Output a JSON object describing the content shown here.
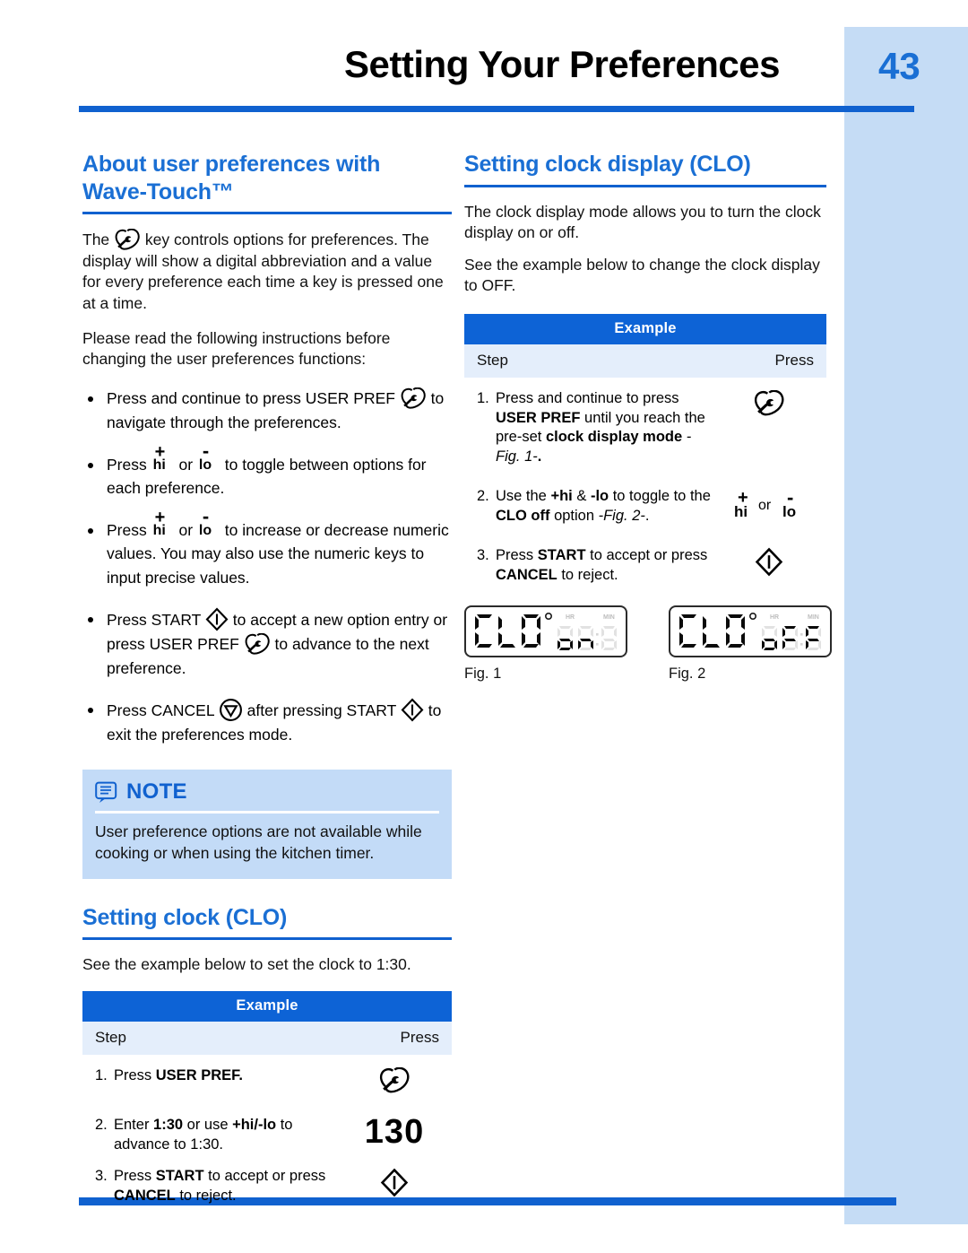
{
  "header": {
    "title": "Setting Your Preferences",
    "page_number": "43"
  },
  "colors": {
    "accent_blue": "#1a6fd4",
    "rule_blue": "#1061cf",
    "table_header_blue": "#0d63d6",
    "table_sub_blue": "#e4eefb",
    "note_bg": "#c3dbf7",
    "edge_band": "#c5dcf5"
  },
  "left_column": {
    "section1": {
      "heading_line1": "About user preferences with",
      "heading_line2": "Wave-Touch™",
      "para1_a": "The ",
      "para1_b": " key controls options for preferences. The display will show a digital abbreviation and a value for every preference each time a key is pressed one at a time.",
      "para2": "Please read the following instructions before changing the user preferences functions:",
      "bullets": [
        {
          "t1": "Press and continue to press USER PREF ",
          "t2": " to navigate through the preferences."
        },
        {
          "t1": "Press ",
          "t2": " or ",
          "t3": " to toggle between options for each preference."
        },
        {
          "t1": "Press ",
          "t2": " or ",
          "t3": " to increase or decrease numeric values. You may also use the numeric keys to input precise values."
        },
        {
          "t1": "Press START ",
          "t2": " to accept a new option entry or press USER PREF ",
          "t3": " to advance to the next preference."
        },
        {
          "t1": "Press CANCEL ",
          "t2": " after pressing START ",
          "t3": " to exit the preferences mode."
        }
      ]
    },
    "note": {
      "title": "NOTE",
      "body": "User preference options are not available while cooking or when using the kitchen timer."
    },
    "section2": {
      "heading": "Setting clock (CLO)",
      "intro": "See the example below to set the clock to 1:30.",
      "table": {
        "title": "Example",
        "col_step": "Step",
        "col_press": "Press",
        "rows": [
          {
            "number": "1.",
            "parts": [
              {
                "text": "Press ",
                "bold": false
              },
              {
                "text": "USER PREF.",
                "bold": true
              }
            ],
            "press_icon": "user-pref-icon"
          },
          {
            "number": "2.",
            "parts": [
              {
                "text": "Enter ",
                "bold": false
              },
              {
                "text": "1:30",
                "bold": true
              },
              {
                "text": " or use ",
                "bold": false
              },
              {
                "text": "+hi/-lo",
                "bold": true
              },
              {
                "text": " to advance to 1:30.",
                "bold": false
              }
            ],
            "press_value": "130"
          },
          {
            "number": "3.",
            "parts": [
              {
                "text": "Press ",
                "bold": false
              },
              {
                "text": "START",
                "bold": true
              },
              {
                "text": " to accept or press ",
                "bold": false
              },
              {
                "text": "CANCEL",
                "bold": true
              },
              {
                "text": " to reject.",
                "bold": false
              }
            ],
            "press_icon": "start-icon"
          }
        ]
      }
    }
  },
  "right_column": {
    "section": {
      "heading": "Setting clock display (CLO)",
      "para1": "The clock display mode allows you to turn the clock display on or off.",
      "para2": "See the example below to change the clock display to OFF.",
      "table": {
        "title": "Example",
        "col_step": "Step",
        "col_press": "Press",
        "rows": [
          {
            "number": "1.",
            "parts": [
              {
                "text": "Press and continue to press ",
                "bold": false
              },
              {
                "text": "USER PREF",
                "bold": true
              },
              {
                "text": " until you reach the pre-set ",
                "bold": false
              },
              {
                "text": "clock display mode ",
                "bold": true
              },
              {
                "text": "-Fig. 1-",
                "bold": false,
                "italic": true
              },
              {
                "text": ".",
                "bold": true
              }
            ],
            "press_icon": "user-pref-icon"
          },
          {
            "number": "2.",
            "parts": [
              {
                "text": "Use the ",
                "bold": false
              },
              {
                "text": "+hi",
                "bold": true
              },
              {
                "text": " & ",
                "bold": false
              },
              {
                "text": "-lo",
                "bold": true
              },
              {
                "text": " to toggle to the ",
                "bold": false
              },
              {
                "text": "CLO off",
                "bold": true
              },
              {
                "text": " option  ",
                "bold": false
              },
              {
                "text": "-Fig. 2-",
                "bold": false,
                "italic": true
              },
              {
                "text": ".",
                "bold": false
              }
            ],
            "press_icon": "hi-lo-icon"
          },
          {
            "number": "3.",
            "parts": [
              {
                "text": "Press ",
                "bold": false
              },
              {
                "text": "START",
                "bold": true
              },
              {
                "text": " to accept or press ",
                "bold": false
              },
              {
                "text": "CANCEL",
                "bold": true
              },
              {
                "text": " to reject.",
                "bold": false
              }
            ],
            "press_icon": "start-icon"
          }
        ]
      },
      "figures": [
        {
          "caption": "Fig. 1",
          "lcd_main": "CLO",
          "lcd_value": "on",
          "lcd_hr_label": "HR",
          "lcd_min_label": "MIN"
        },
        {
          "caption": "Fig. 2",
          "lcd_main": "CLO",
          "lcd_value": "oFF",
          "lcd_hr_label": "HR",
          "lcd_min_label": "MIN"
        }
      ]
    }
  },
  "glyphs": {
    "plus": "+",
    "minus": "-",
    "hi": "hi",
    "lo": "lo",
    "or": "or"
  }
}
